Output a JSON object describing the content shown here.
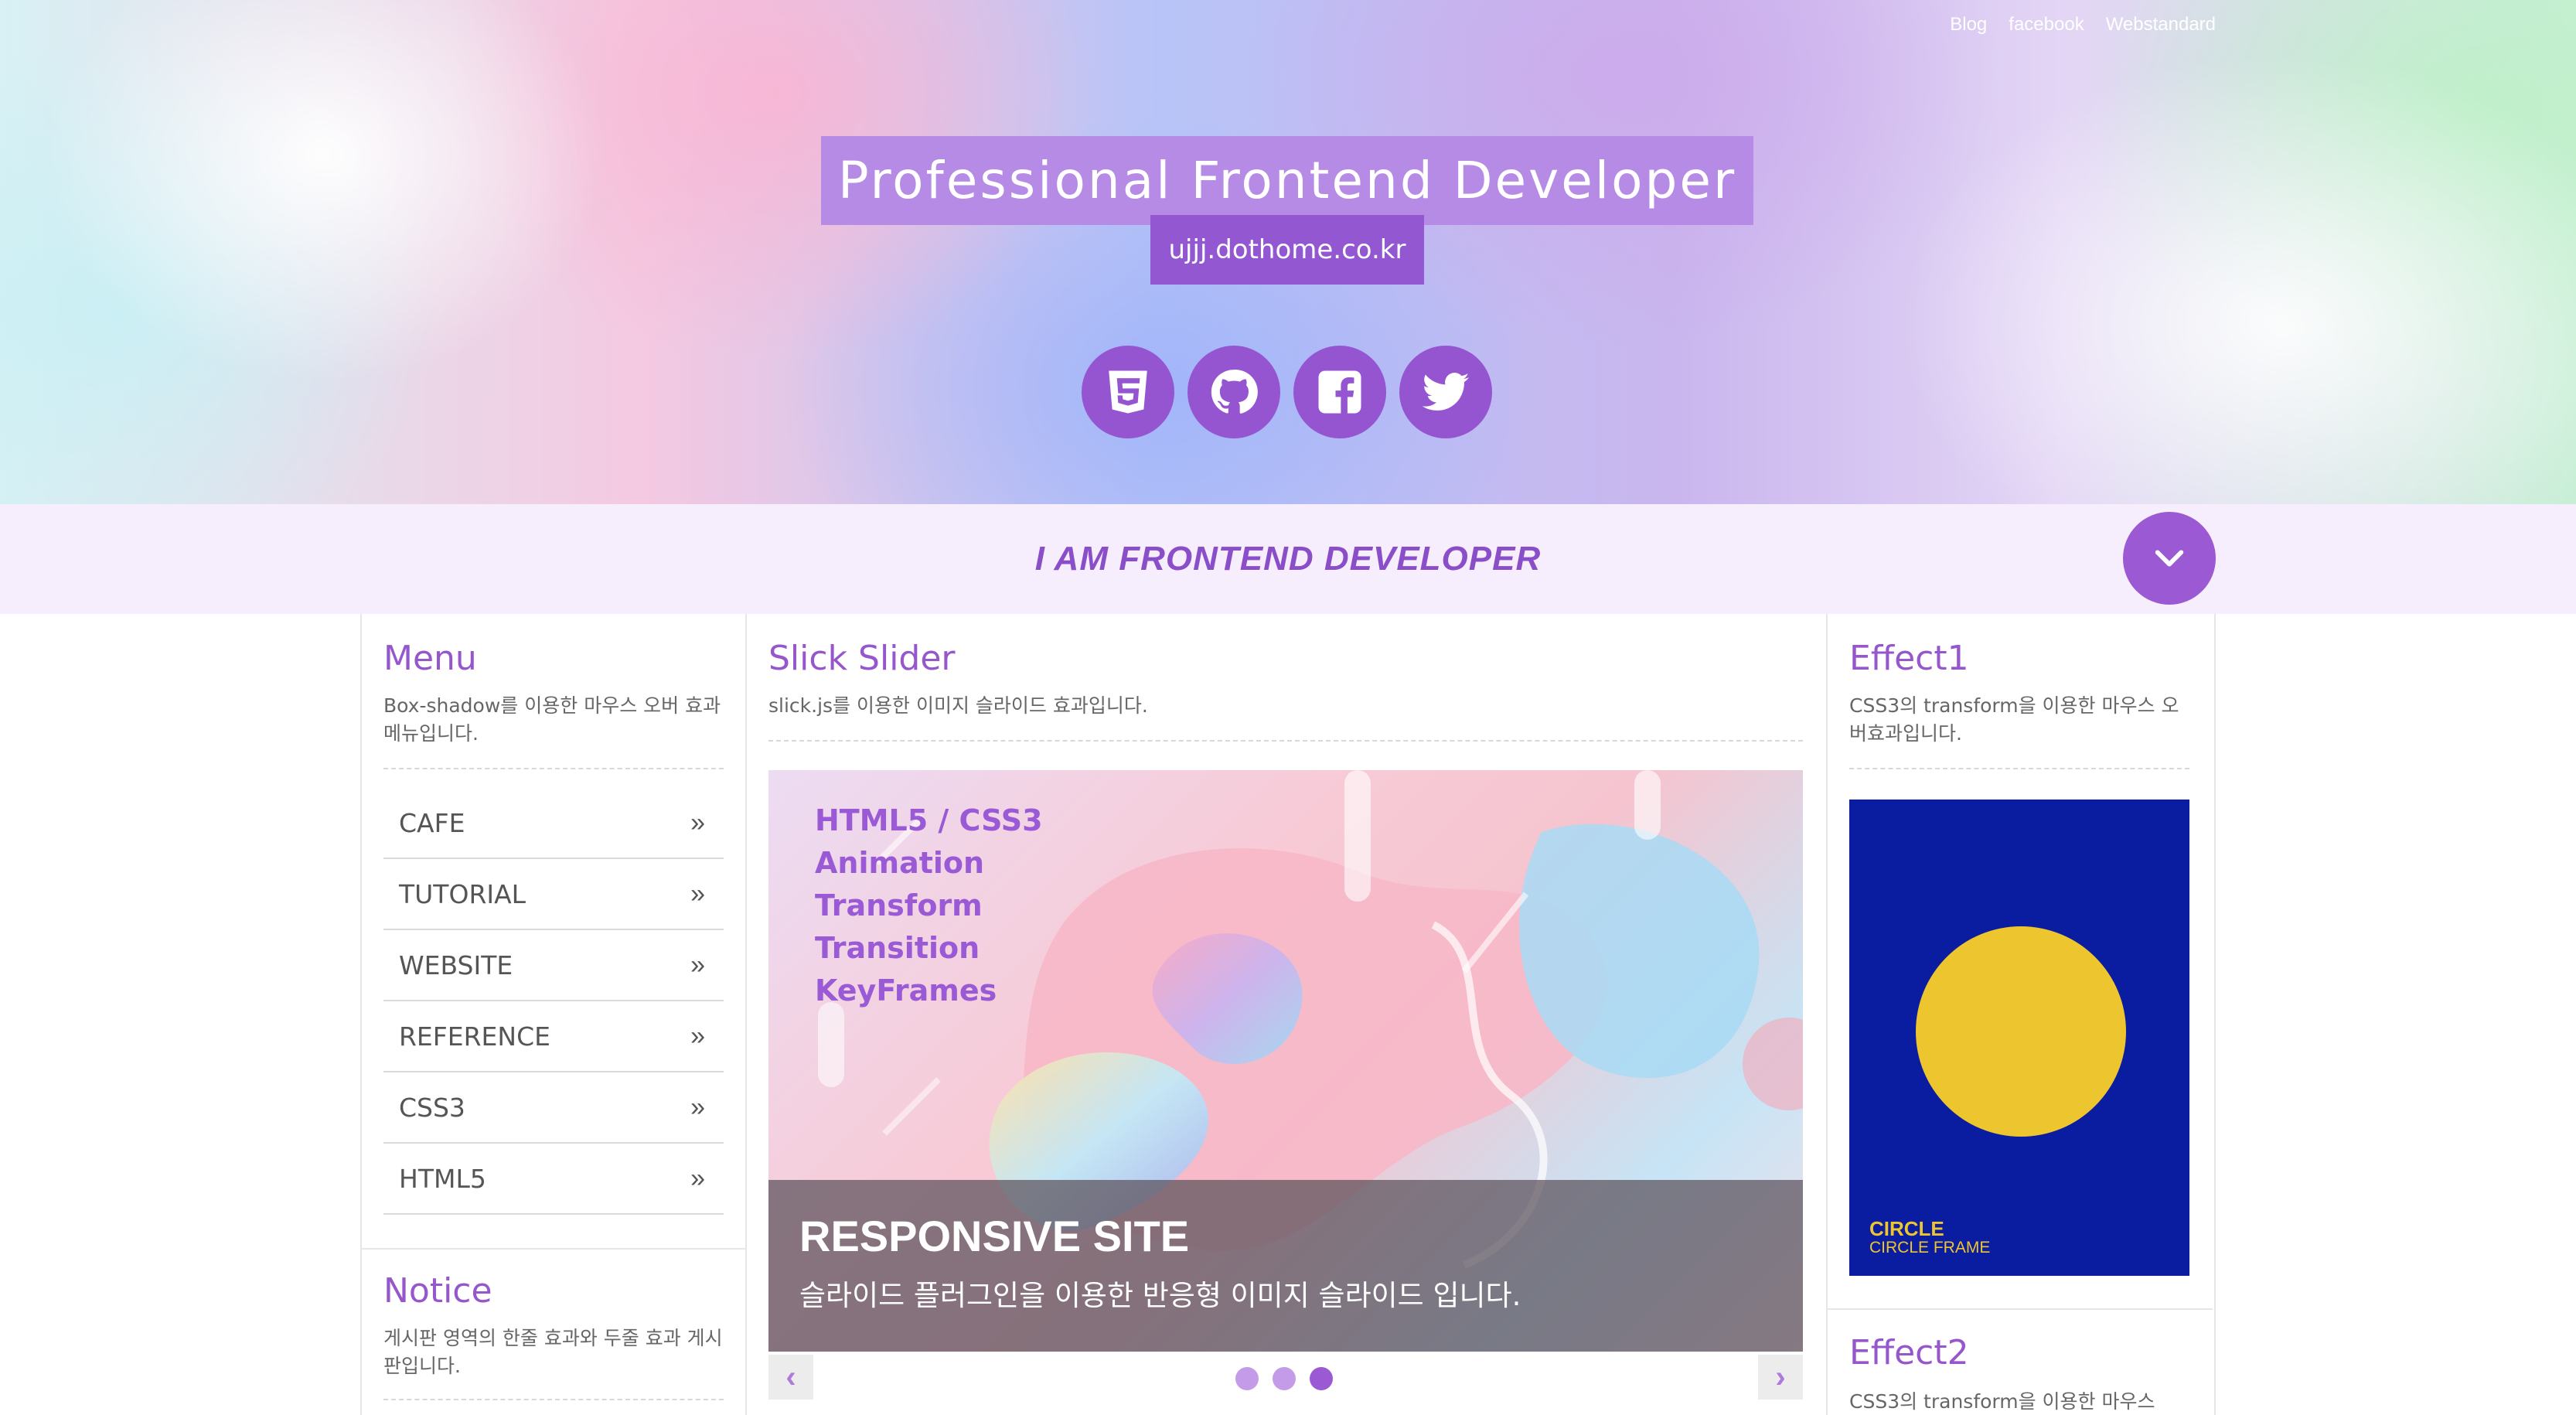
{
  "header": {
    "links": [
      "Blog",
      "facebook",
      "Webstandard"
    ],
    "title": "Professional Frontend Developer",
    "url": "ujjj.dothome.co.kr",
    "social_icons": [
      "html5-icon",
      "github-icon",
      "facebook-icon",
      "twitter-icon"
    ]
  },
  "band": {
    "tagline": "I AM FRONTEND DEVELOPER"
  },
  "menu": {
    "title": "Menu",
    "desc": "Box-shadow를 이용한 마우스 오버 효과 메뉴입니다.",
    "items": [
      "CAFE",
      "TUTORIAL",
      "WEBSITE",
      "REFERENCE",
      "CSS3",
      "HTML5"
    ],
    "arrow": "»"
  },
  "notice": {
    "title": "Notice",
    "desc": "게시판 영역의 한줄 효과와 두줄 효과 게시판입니다."
  },
  "slider": {
    "title": "Slick Slider",
    "desc": "slick.js를 이용한 이미지 슬라이드 효과입니다.",
    "slide_lines": [
      "HTML5 / CSS3",
      "Animation",
      "Transform",
      "Transition",
      "KeyFrames"
    ],
    "caption_title": "RESPONSIVE SITE",
    "caption_desc": "슬라이드 플러그인을 이용한 반응형 이미지 슬라이드 입니다.",
    "prev": "‹",
    "next": "›",
    "dots": 3,
    "active_dot": 3
  },
  "effect1": {
    "title": "Effect1",
    "desc": "CSS3의 transform을 이용한 마우스 오버효과입니다.",
    "poster_title": "CIRCLE",
    "poster_sub": "CIRCLE FRAME"
  },
  "effect2": {
    "title": "Effect2",
    "desc": "CSS3의 transform을 이용한 마우스"
  },
  "colors": {
    "accent": "#9b59d3",
    "title_box": "#b68be6",
    "url_box": "#9257d1",
    "band": "#f7eefd",
    "poster_bg": "#0a1ca0",
    "poster_circle": "#edc52f"
  }
}
